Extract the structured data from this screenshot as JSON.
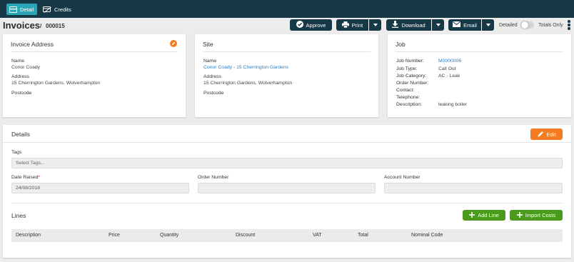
{
  "nav": {
    "tabs": [
      {
        "label": "Detail",
        "icon": "card-icon"
      },
      {
        "label": "Credits",
        "icon": "credit-card-icon"
      }
    ]
  },
  "header": {
    "title": "Invoices",
    "separator": "/",
    "number": "000015",
    "actions": {
      "approve": "Approve",
      "print": "Print",
      "download": "Download",
      "email": "Email"
    },
    "toggle": {
      "left": "Detailed",
      "right": "Totals Only",
      "totals_only": false
    }
  },
  "invoice_address": {
    "title": "Invoice Address",
    "name_label": "Name",
    "name": "Conor Coady",
    "address_label": "Address",
    "address": "15 Cherrington Gardens, Wolverhampton",
    "postcode_label": "Postcode",
    "postcode": ""
  },
  "site": {
    "title": "Site",
    "name_label": "Name",
    "name": "Conor Coady - 15 Cherrington Gardens",
    "address_label": "Address",
    "address": "15 Cherrington Gardens, Wolverhampton",
    "postcode_label": "Postcode",
    "postcode": ""
  },
  "job": {
    "title": "Job",
    "fields": [
      {
        "label": "Job Number:",
        "value": "M0000006"
      },
      {
        "label": "Job Type:",
        "value": "Call Out"
      },
      {
        "label": "Job Category:",
        "value": "AC - Leak"
      },
      {
        "label": "Order Number:",
        "value": ""
      },
      {
        "label": "Contact:",
        "value": ""
      },
      {
        "label": "Telephone:",
        "value": ""
      },
      {
        "label": "Description:",
        "value": "leaking boiler"
      }
    ]
  },
  "details": {
    "title": "Details",
    "edit_label": "Edit",
    "tags_label": "Tags",
    "tags_placeholder": "Select Tags...",
    "date_raised_label": "Date Raised",
    "required_mark": "*",
    "date_raised": "24/08/2018",
    "order_number_label": "Order Number",
    "order_number": "",
    "account_number_label": "Account Number",
    "account_number": ""
  },
  "lines": {
    "title": "Lines",
    "add_line": "Add Line",
    "import_costs": "Import Costs",
    "columns": [
      "Description",
      "Price",
      "Quantity",
      "Discount",
      "VAT",
      "Total",
      "Nominal Code"
    ]
  },
  "colors": {
    "navbar": "#163847",
    "active_tab": "#2aa5b6",
    "accent_orange": "#f47c20",
    "accent_green": "#4a9a1c",
    "link": "#2d7bbf"
  }
}
